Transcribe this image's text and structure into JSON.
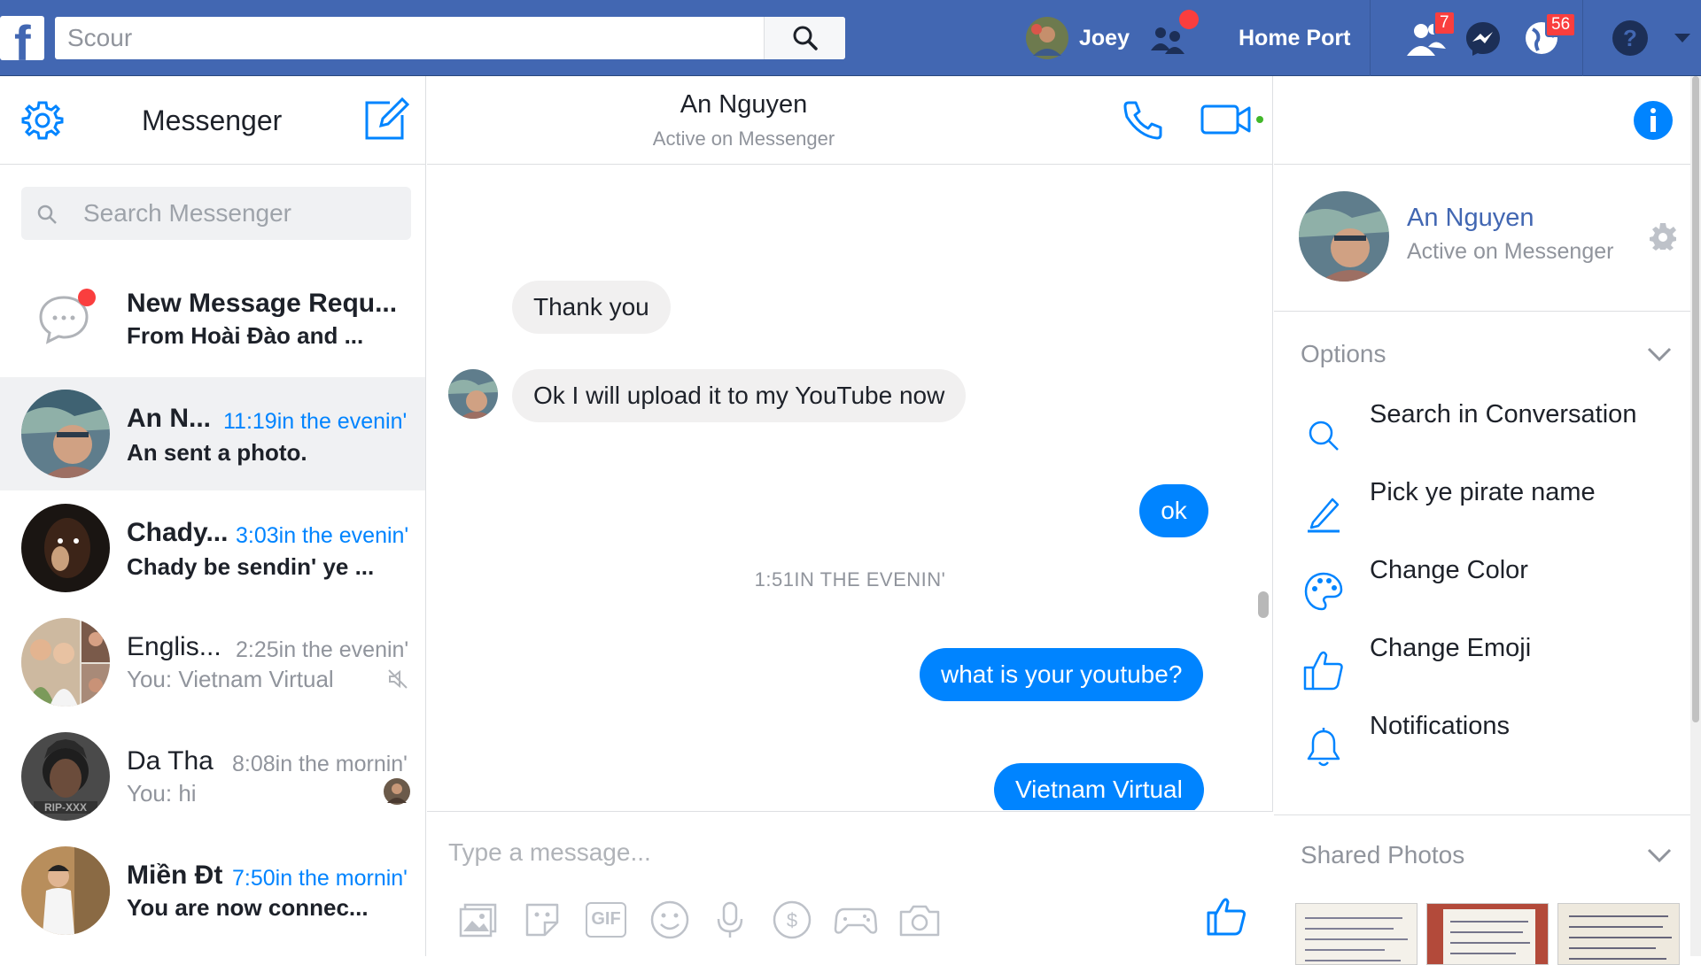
{
  "topbar": {
    "search_placeholder": "Scour",
    "profile_name": "Joey",
    "home_label": "Home Port",
    "friend_requests_count": "7",
    "notifications_count": "56",
    "colors": {
      "bar": "#4267b2",
      "badge": "#fa3e3e"
    }
  },
  "left": {
    "title": "Messenger",
    "search_placeholder": "Search Messenger",
    "conversations": [
      {
        "name": "New Message Requ...",
        "time": "",
        "snippet": "From Hoài Đào and ...",
        "unread": true
      },
      {
        "name": "An N...",
        "time": "11:19in the evenin'",
        "snippet": "An sent a photo.",
        "unread": true
      },
      {
        "name": "Chady...",
        "time": "3:03in the evenin'",
        "snippet": "Chady be sendin' ye ...",
        "unread": true
      },
      {
        "name": "Englis...",
        "time": "2:25in the evenin'",
        "snippet": "You: Vietnam Virtual",
        "unread": false,
        "muted": true
      },
      {
        "name": "Da Tha",
        "time": "8:08in the mornin'",
        "snippet": "You: hi",
        "unread": false
      },
      {
        "name": "Miền Đt",
        "time": "7:50in the mornin'",
        "snippet": "You are now connec...",
        "unread": true
      }
    ]
  },
  "center": {
    "contact_name": "An Nguyen",
    "contact_status": "Active on Messenger",
    "messages": [
      {
        "from": "them",
        "text": "Thank you"
      },
      {
        "from": "them",
        "text": "Ok I will upload it to my YouTube now"
      },
      {
        "from": "me",
        "text": "ok"
      },
      {
        "from": "me",
        "text": "what is your youtube?"
      },
      {
        "from": "me",
        "text": "Vietnam Virtual"
      }
    ],
    "time_divider": "1:51IN THE EVENIN'",
    "composer_placeholder": "Type a message...",
    "gif_label": "GIF",
    "accent_color": "#0084ff"
  },
  "right": {
    "name": "An Nguyen",
    "status": "Active on Messenger",
    "options_title": "Options",
    "options": [
      {
        "label": "Search in Conversation",
        "icon": "search-icon"
      },
      {
        "label": "Pick ye pirate name",
        "icon": "pencil-icon"
      },
      {
        "label": "Change Color",
        "icon": "palette-icon"
      },
      {
        "label": "Change Emoji",
        "icon": "thumbs-up-icon"
      },
      {
        "label": "Notifications",
        "icon": "bell-icon"
      }
    ],
    "shared_photos_title": "Shared Photos"
  }
}
